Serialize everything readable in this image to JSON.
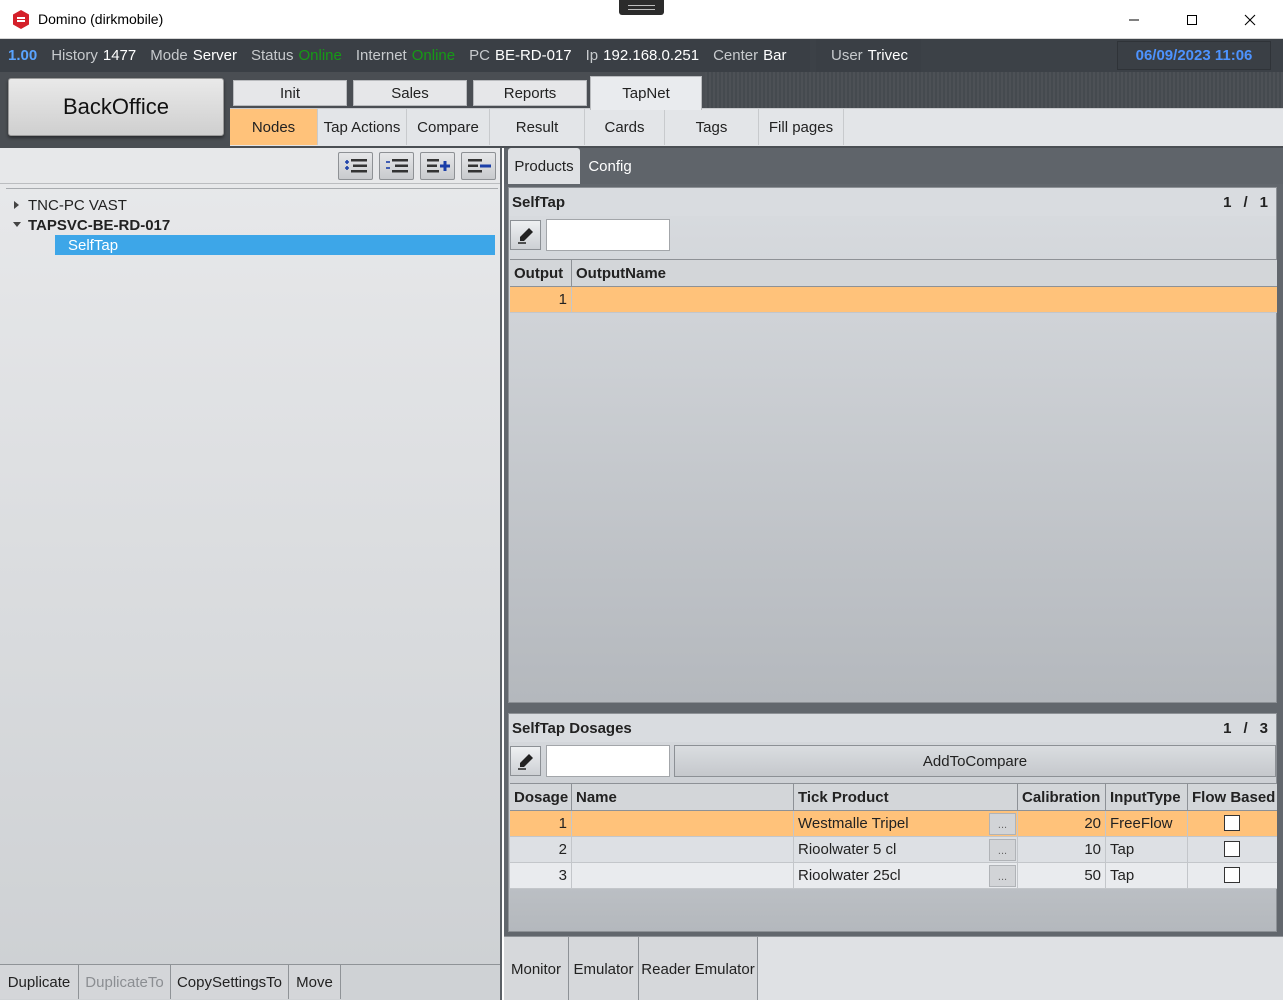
{
  "window": {
    "title": "Domino (dirkmobile)"
  },
  "status": {
    "version": "1.00",
    "history_label": "History",
    "history_value": "1477",
    "mode_label": "Mode",
    "mode_value": "Server",
    "status_label": "Status",
    "status_value": "Online",
    "internet_label": "Internet",
    "internet_value": "Online",
    "pc_label": "PC",
    "pc_value": "BE-RD-017",
    "ip_label": "Ip",
    "ip_value": "192.168.0.251",
    "center_label": "Center",
    "center_value": "Bar",
    "user_label": "User",
    "user_value": "Trivec",
    "datetime": "06/09/2023 11:06",
    "online_color": "#169a16",
    "date_color": "#4d93ff"
  },
  "menu": {
    "backoffice": "BackOffice",
    "tabs": [
      "Init",
      "Sales",
      "Reports",
      "TapNet"
    ],
    "active_tab": "TapNet",
    "subtabs": [
      "Nodes",
      "Tap Actions",
      "Compare",
      "Result",
      "Cards",
      "Tags",
      "Fill pages"
    ],
    "active_subtab": "Nodes",
    "accent_color": "#ffc27a"
  },
  "tree": {
    "nodes": [
      {
        "label": "TNC-PC VAST",
        "expanded": false
      },
      {
        "label": "TAPSVC-BE-RD-017",
        "expanded": true
      }
    ],
    "selected_child": "SelfTap",
    "toolbar_icons": [
      "expand-all-icon",
      "collapse-all-icon",
      "add-node-icon",
      "remove-node-icon"
    ]
  },
  "left_bottom": {
    "buttons": [
      "Duplicate",
      "DuplicateTo",
      "CopySettingsTo",
      "Move"
    ]
  },
  "right": {
    "tabs": [
      "Products",
      "Config"
    ],
    "active_tab": "Products",
    "products_panel": {
      "title": "SelfTap",
      "page_current": "1",
      "page_sep": "/",
      "page_total": "1",
      "input_value": "",
      "columns": [
        "Output",
        "OutputName"
      ],
      "rows": [
        {
          "output": "1",
          "output_name": ""
        }
      ]
    },
    "dosages_panel": {
      "title": "SelfTap Dosages",
      "page_current": "1",
      "page_sep": "/",
      "page_total": "3",
      "input_value": "",
      "add_button": "AddToCompare",
      "columns": [
        "Dosage",
        "Name",
        "Tick Product",
        "Calibration",
        "InputType",
        "Flow Based"
      ],
      "ellipsis": "...",
      "rows": [
        {
          "dosage": "1",
          "name": "",
          "tick_product": "Westmalle Tripel",
          "calibration": "20",
          "input_type": "FreeFlow",
          "flow_based": false
        },
        {
          "dosage": "2",
          "name": "",
          "tick_product": "Rioolwater 5 cl",
          "calibration": "10",
          "input_type": "Tap",
          "flow_based": false
        },
        {
          "dosage": "3",
          "name": "",
          "tick_product": "Rioolwater 25cl",
          "calibration": "50",
          "input_type": "Tap",
          "flow_based": false
        }
      ]
    },
    "bottom_tabs": [
      "Monitor",
      "Emulator",
      "Reader Emulator"
    ]
  }
}
